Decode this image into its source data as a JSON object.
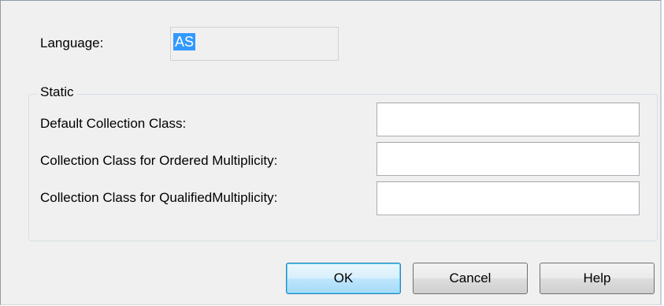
{
  "language": {
    "label": "Language:",
    "value": "AS"
  },
  "static_group": {
    "title": "Static",
    "fields": [
      {
        "label": "Default Collection Class:",
        "value": ""
      },
      {
        "label": "Collection Class for Ordered Multiplicity:",
        "value": ""
      },
      {
        "label": "Collection Class for QualifiedMultiplicity:",
        "value": ""
      }
    ]
  },
  "buttons": {
    "ok": "OK",
    "cancel": "Cancel",
    "help": "Help"
  },
  "colors": {
    "dialog_background": "#f0f0f0",
    "selection_highlight": "#3399ff",
    "default_button_border": "#3c7fb1"
  }
}
